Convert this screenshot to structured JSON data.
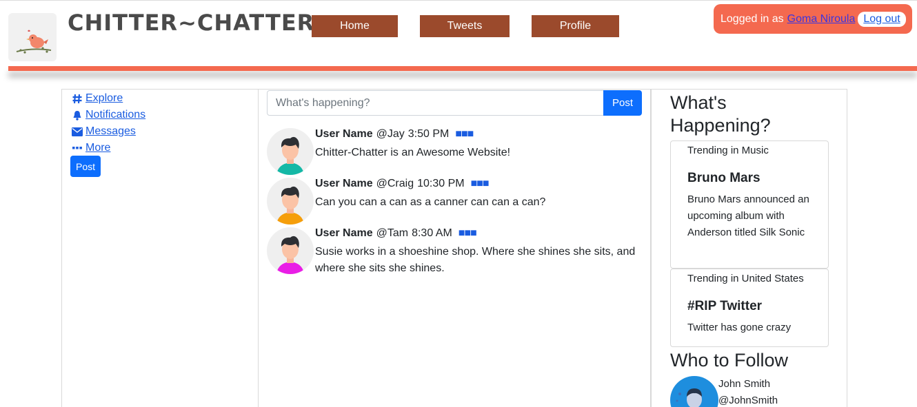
{
  "header": {
    "brand": "CHITTER~CHATTER",
    "nav": [
      {
        "label": "Home"
      },
      {
        "label": "Tweets"
      },
      {
        "label": "Profile"
      }
    ],
    "login_prefix": "Logged in as",
    "login_user": "Goma Niroula",
    "logout_label": "Log out"
  },
  "sidebar": {
    "items": [
      {
        "label": " Explore",
        "icon": "hash-icon"
      },
      {
        "label": " Notifications",
        "icon": "bell-icon"
      },
      {
        "label": " Messages",
        "icon": "envelope-icon"
      },
      {
        "label": " More",
        "icon": "ellipsis-icon"
      }
    ],
    "post_label": "Post"
  },
  "composer": {
    "placeholder": "What's happening?",
    "post_label": "Post"
  },
  "tweets": [
    {
      "name": "User Name",
      "handle": "@Jay",
      "time": "3:50 PM",
      "text": "Chitter-Chatter is an Awesome Website!",
      "shirt_color": "#14b8a6"
    },
    {
      "name": "User Name",
      "handle": "@Craig",
      "time": "10:30 PM",
      "text": "Can you can a can as a canner can can a can?",
      "shirt_color": "#f59e0b"
    },
    {
      "name": "User Name",
      "handle": "@Tam",
      "time": "8:30 AM",
      "text": "Susie works in a shoeshine shop. Where she shines she sits, and where she sits she shines.",
      "shirt_color": "#e91ee6"
    }
  ],
  "right": {
    "happening_title": "What's Happening?",
    "trends": [
      {
        "category": "Trending in Music",
        "title": "Bruno Mars",
        "body": "Bruno Mars announced an upcoming album with Anderson titled Silk Sonic"
      },
      {
        "category": "Trending in United States",
        "title": "#RIP Twitter",
        "body": "Twitter has gone crazy"
      }
    ],
    "follow_title": "Who to Follow",
    "follow": {
      "name": "John Smith",
      "handle": "@JohnSmith"
    }
  },
  "colors": {
    "accent": "#f4694f",
    "nav_button": "#9b4a2c",
    "primary": "#0d6efd",
    "link": "#1a5ce0"
  }
}
